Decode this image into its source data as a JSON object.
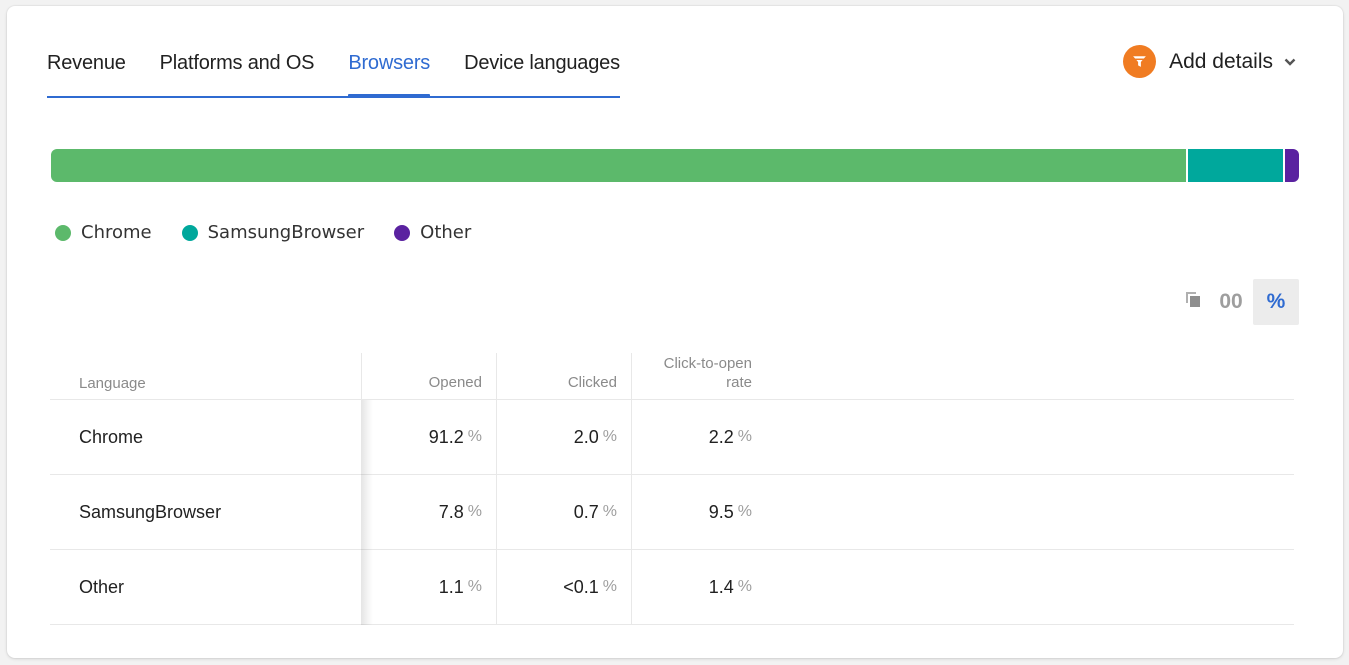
{
  "tabs": [
    {
      "label": "Revenue",
      "active": false
    },
    {
      "label": "Platforms and OS",
      "active": false
    },
    {
      "label": "Browsers",
      "active": true
    },
    {
      "label": "Device languages",
      "active": false
    }
  ],
  "add_details": {
    "label": "Add details",
    "icon": "funnel-icon"
  },
  "colors": {
    "accent": "#2f6bd1",
    "chrome": "#5cb96b",
    "samsung": "#00a89c",
    "other": "#5a22a0",
    "add_details_icon_bg": "#f07c22"
  },
  "chart_data": {
    "type": "bar",
    "orientation": "horizontal-stacked",
    "categories": [
      "Chrome",
      "SamsungBrowser",
      "Other"
    ],
    "values": [
      91.2,
      7.8,
      1.1
    ],
    "colors": [
      "#5cb96b",
      "#00a89c",
      "#5a22a0"
    ],
    "legend": "bottom-left",
    "unit": "%"
  },
  "legend": [
    {
      "label": "Chrome",
      "color": "#5cb96b"
    },
    {
      "label": "SamsungBrowser",
      "color": "#00a89c"
    },
    {
      "label": "Other",
      "color": "#5a22a0"
    }
  ],
  "view_toggle": {
    "copy_icon": "copy-icon",
    "absolute_label": "00",
    "percent_label": "%",
    "selected": "percent"
  },
  "table": {
    "columns": [
      "Language",
      "Opened",
      "Clicked",
      "Click-to-open rate"
    ],
    "column_lines": [
      [
        "Language"
      ],
      [
        "Opened"
      ],
      [
        "Clicked"
      ],
      [
        "Click-to-open",
        "rate"
      ]
    ],
    "unit": "%",
    "rows": [
      {
        "name": "Chrome",
        "opened": "91.2",
        "clicked": "2.0",
        "cto": "2.2"
      },
      {
        "name": "SamsungBrowser",
        "opened": "7.8",
        "clicked": "0.7",
        "cto": "9.5"
      },
      {
        "name": "Other",
        "opened": "1.1",
        "clicked": "<0.1",
        "cto": "1.4"
      }
    ]
  }
}
